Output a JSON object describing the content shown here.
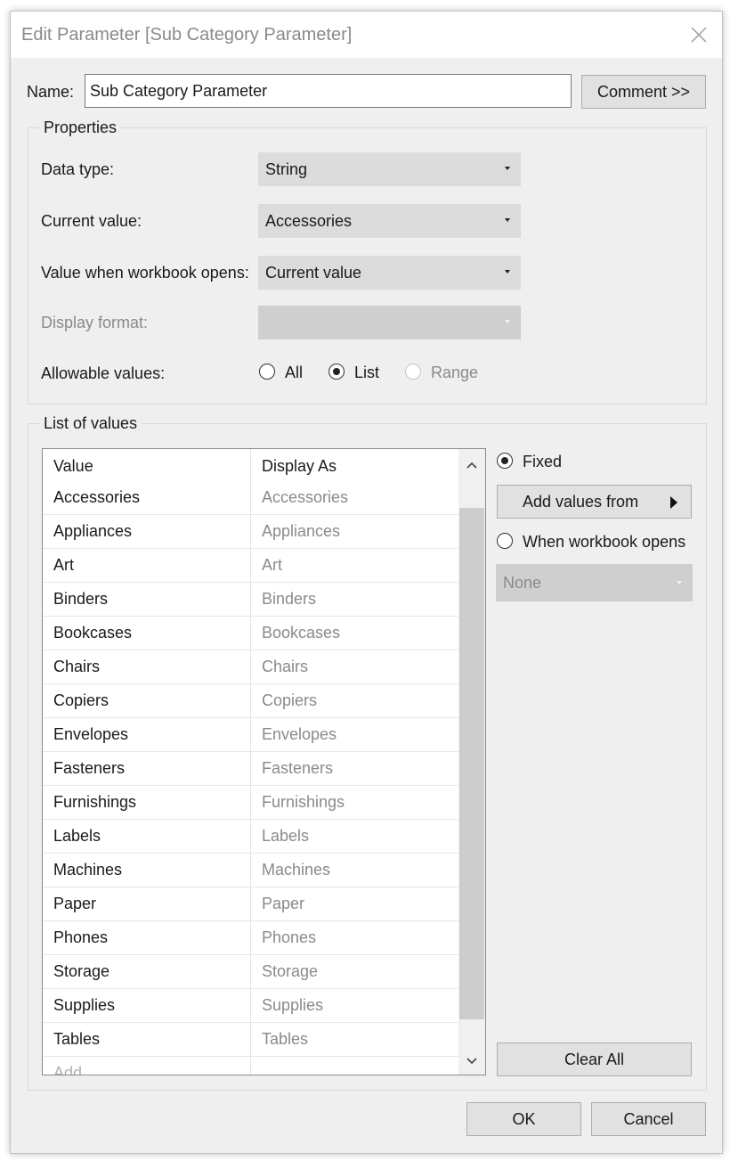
{
  "dialog": {
    "title": "Edit Parameter [Sub Category Parameter]",
    "name_label": "Name:",
    "name_value": "Sub Category Parameter",
    "comment_button": "Comment >>"
  },
  "properties": {
    "legend": "Properties",
    "data_type_label": "Data type:",
    "data_type_value": "String",
    "current_value_label": "Current value:",
    "current_value": "Accessories",
    "open_value_label": "Value when workbook opens:",
    "open_value": "Current value",
    "display_format_label": "Display format:",
    "display_format_value": "",
    "allowable_label": "Allowable values:",
    "allowable_options": [
      "All",
      "List",
      "Range"
    ],
    "allowable_selected": "List"
  },
  "list_of_values": {
    "legend": "List of values",
    "col_value": "Value",
    "col_display": "Display As",
    "rows": [
      {
        "value": "Accessories",
        "display": "Accessories"
      },
      {
        "value": "Appliances",
        "display": "Appliances"
      },
      {
        "value": "Art",
        "display": "Art"
      },
      {
        "value": "Binders",
        "display": "Binders"
      },
      {
        "value": "Bookcases",
        "display": "Bookcases"
      },
      {
        "value": "Chairs",
        "display": "Chairs"
      },
      {
        "value": "Copiers",
        "display": "Copiers"
      },
      {
        "value": "Envelopes",
        "display": "Envelopes"
      },
      {
        "value": "Fasteners",
        "display": "Fasteners"
      },
      {
        "value": "Furnishings",
        "display": "Furnishings"
      },
      {
        "value": "Labels",
        "display": "Labels"
      },
      {
        "value": "Machines",
        "display": "Machines"
      },
      {
        "value": "Paper",
        "display": "Paper"
      },
      {
        "value": "Phones",
        "display": "Phones"
      },
      {
        "value": "Storage",
        "display": "Storage"
      },
      {
        "value": "Supplies",
        "display": "Supplies"
      },
      {
        "value": "Tables",
        "display": "Tables"
      }
    ],
    "add_placeholder": "Add",
    "fixed_label": "Fixed",
    "add_values_from": "Add values from",
    "when_opens_label": "When workbook opens",
    "when_opens_value": "None",
    "clear_all": "Clear All"
  },
  "footer": {
    "ok": "OK",
    "cancel": "Cancel"
  },
  "icons": {
    "close": "close-icon",
    "dropdown": "dropdown-arrow-icon",
    "scroll_up": "chevron-up-icon",
    "scroll_down": "chevron-down-icon",
    "submenu": "triangle-right-icon"
  },
  "colors": {
    "dialog_bg": "#efefef",
    "combo_bg": "#dcdcdc",
    "button_bg": "#e1e1e1",
    "disabled_text": "#8a8a8a"
  }
}
